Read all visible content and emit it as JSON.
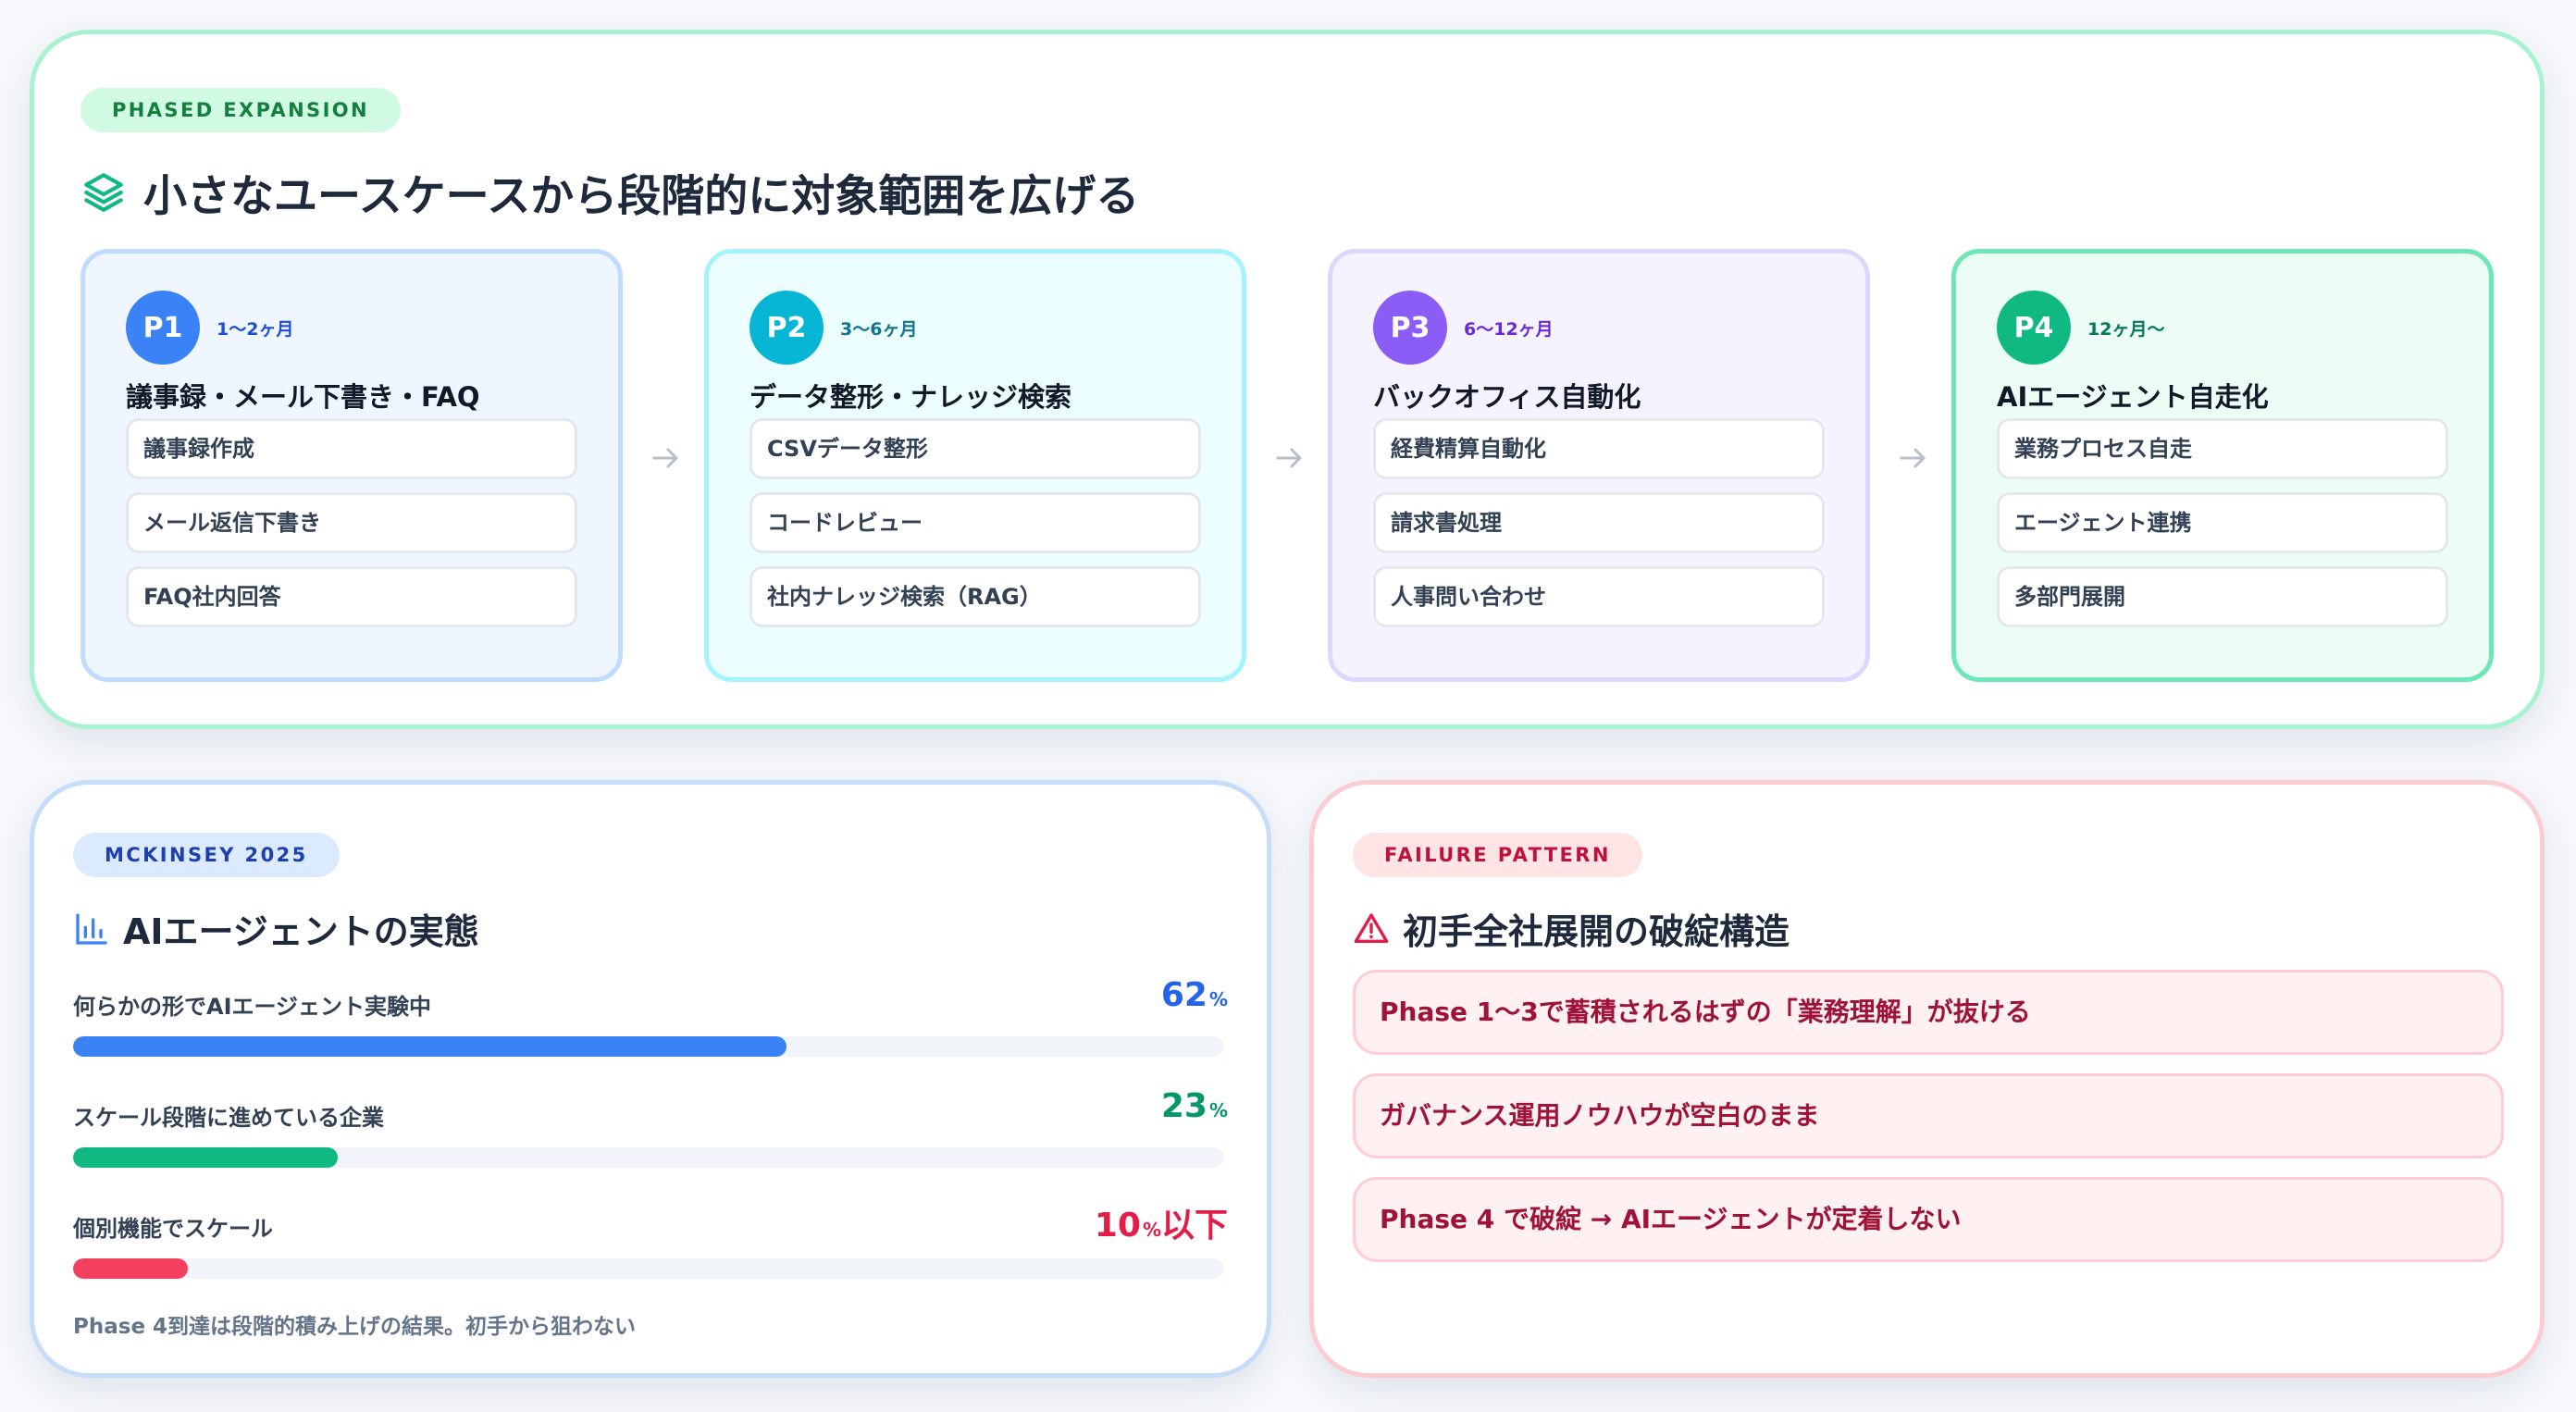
{
  "expansion": {
    "badge": "PHASED EXPANSION",
    "title": "小さなユースケースから段階的に対象範囲を広げる",
    "title_icon": "layers-icon",
    "phases": [
      {
        "code": "P1",
        "period": "1〜2ヶ月",
        "name": "議事録・メール下書き・FAQ",
        "items": [
          "議事録作成",
          "メール返信下書き",
          "FAQ社内回答"
        ]
      },
      {
        "code": "P2",
        "period": "3〜6ヶ月",
        "name": "データ整形・ナレッジ検索",
        "items": [
          "CSVデータ整形",
          "コードレビュー",
          "社内ナレッジ検索（RAG）"
        ]
      },
      {
        "code": "P3",
        "period": "6〜12ヶ月",
        "name": "バックオフィス自動化",
        "items": [
          "経費精算自動化",
          "請求書処理",
          "人事問い合わせ"
        ]
      },
      {
        "code": "P4",
        "period": "12ヶ月〜",
        "name": "AIエージェント自走化",
        "items": [
          "業務プロセス自走",
          "エージェント連携",
          "多部門展開"
        ]
      }
    ]
  },
  "stats": {
    "badge": "MCKINSEY 2025",
    "title": "AIエージェントの実態",
    "title_icon": "bar-chart-icon",
    "items": [
      {
        "label": "何らかの形でAIエージェント実験中",
        "value": "62",
        "unit": "%",
        "suffix": "",
        "percent": 62,
        "color": "#3b82f6"
      },
      {
        "label": "スケール段階に進めている企業",
        "value": "23",
        "unit": "%",
        "suffix": "",
        "percent": 23,
        "color": "#10b981"
      },
      {
        "label": "個別機能でスケール",
        "value": "10",
        "unit": "%",
        "suffix": "以下",
        "percent": 10,
        "color": "#f43f5e"
      }
    ],
    "note": "Phase 4到達は段階的積み上げの結果。初手から狙わない"
  },
  "failure": {
    "badge": "FAILURE PATTERN",
    "title": "初手全社展開の破綻構造",
    "title_icon": "warning-icon",
    "items": [
      "Phase 1〜3で蓄積されるはずの「業務理解」が抜ける",
      "ガバナンス運用ノウハウが空白のまま",
      "Phase 4 で破綻 → AIエージェントが定着しない"
    ]
  }
}
